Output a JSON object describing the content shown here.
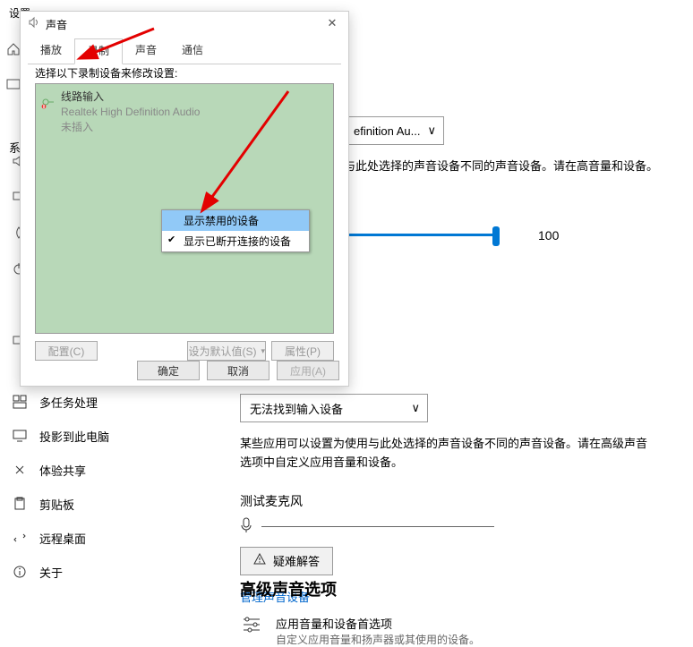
{
  "settings": {
    "window_title": "设置",
    "rail_label": "系",
    "sidebar_items": [
      {
        "icon": "multitask",
        "label": "多任务处理"
      },
      {
        "icon": "project",
        "label": "投影到此电脑"
      },
      {
        "icon": "share",
        "label": "体验共享"
      },
      {
        "icon": "clipboard",
        "label": "剪贴板"
      },
      {
        "icon": "remote",
        "label": "远程桌面"
      },
      {
        "icon": "about",
        "label": "关于"
      }
    ]
  },
  "output": {
    "device_dropdown": "efinition Au...",
    "description": "与此处选择的声音设备不同的声音设备。请在高音量和设备。",
    "slider_value": "100"
  },
  "input": {
    "device_dropdown": "无法找到输入设备",
    "description": "某些应用可以设置为使用与此处选择的声音设备不同的声音设备。请在高级声音选项中自定义应用音量和设备。",
    "test_label": "测试麦克风",
    "troubleshoot": "疑难解答",
    "manage_link": "管理声音设备"
  },
  "advanced": {
    "heading": "高级声音选项",
    "pref_title": "应用音量和设备首选项",
    "pref_sub": "自定义应用音量和扬声器或其使用的设备。"
  },
  "dialog": {
    "title": "声音",
    "tabs": [
      "播放",
      "录制",
      "声音",
      "通信"
    ],
    "active_tab": 1,
    "instruction": "选择以下录制设备来修改设置:",
    "device": {
      "name": "线路输入",
      "driver": "Realtek High Definition Audio",
      "status": "未插入"
    },
    "context_menu": [
      {
        "label": "显示禁用的设备",
        "checked": false,
        "highlight": true
      },
      {
        "label": "显示已断开连接的设备",
        "checked": true,
        "highlight": false
      }
    ],
    "buttons": {
      "configure": "配置(C)",
      "set_default": "设为默认值(S)",
      "properties": "属性(P)",
      "ok": "确定",
      "cancel": "取消",
      "apply": "应用(A)"
    }
  }
}
